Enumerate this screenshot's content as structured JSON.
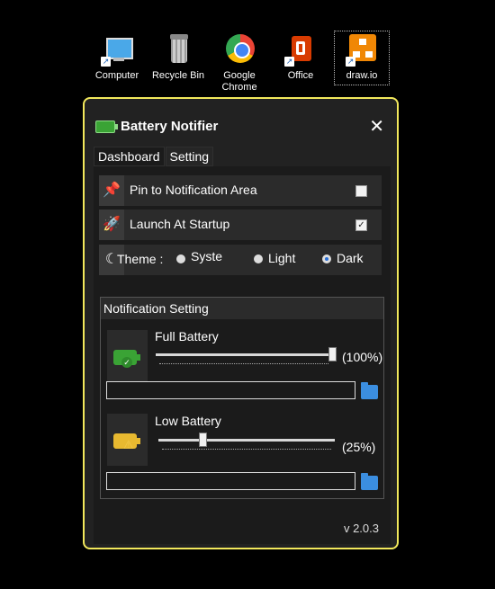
{
  "desktop": {
    "icons": [
      {
        "label": "Computer"
      },
      {
        "label": "Recycle Bin"
      },
      {
        "label": "Google Chrome"
      },
      {
        "label": "Office"
      },
      {
        "label": "draw.io"
      }
    ]
  },
  "window": {
    "title": "Battery Notifier",
    "close": "✕",
    "tabs": [
      "Dashboard",
      "Setting"
    ],
    "active_tab": "Setting",
    "pin": {
      "label": "Pin to Notification Area",
      "checked": false
    },
    "startup": {
      "label": "Launch At Startup",
      "checked": true
    },
    "theme": {
      "label": "Theme :",
      "options": [
        "Syste",
        "Light",
        "Dark"
      ],
      "selected": "Dark"
    },
    "notification": {
      "title": "Notification Setting",
      "full": {
        "label": "Full Battery",
        "value_text": "(100%)",
        "value": 100,
        "path": ""
      },
      "low": {
        "label": "Low Battery",
        "value_text": "(25%)",
        "value": 25,
        "path": ""
      }
    },
    "version": "v 2.0.3"
  },
  "colors": {
    "accent": "#f2e85c",
    "full_battery": "#3aa335",
    "low_battery": "#e8b930",
    "folder": "#3b8ee0"
  }
}
